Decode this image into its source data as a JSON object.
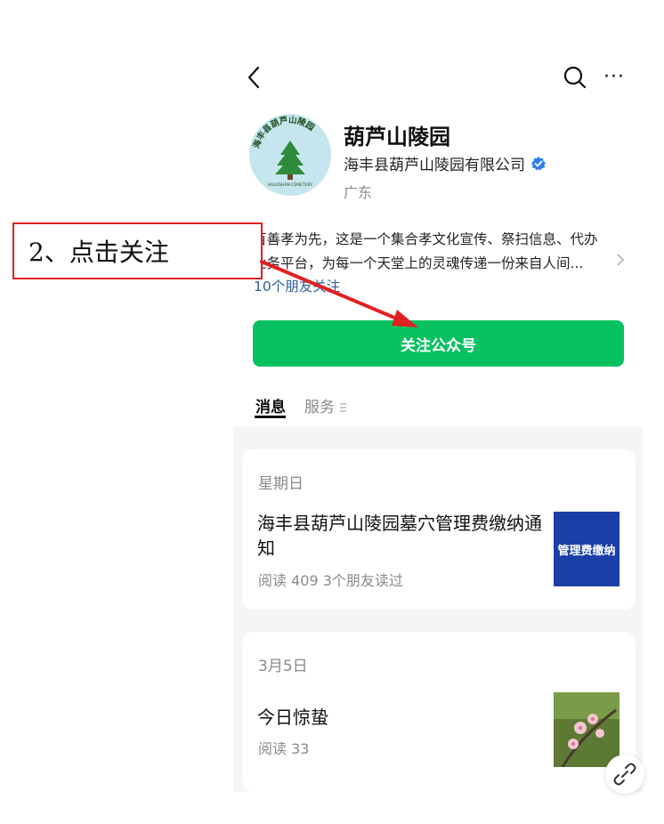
{
  "header": {
    "back_icon": "chevron-left-icon",
    "search_icon": "search-icon",
    "more_label": "···"
  },
  "account": {
    "avatar_text_top": "海丰县葫芦山陵园",
    "avatar_text_bottom": "HULUSHAN CEMETERY",
    "name": "葫芦山陵园",
    "owner": "海丰县葫芦山陵园有限公司",
    "verified_icon": "verified-badge-icon",
    "region": "广东",
    "description_line1": "百善孝为先，这是一个集合孝文化宣传、祭扫信息、代办",
    "description_line2": "业务平台，为每一个天堂上的灵魂传递一份来自人间...",
    "friends_following": "10个朋友关注",
    "follow_button": "关注公众号"
  },
  "tabs": [
    {
      "label": "消息",
      "active": true
    },
    {
      "label": "服务",
      "icon": "menu-lines-icon"
    }
  ],
  "articles": [
    {
      "date": "星期日",
      "title_line1": "海丰县葫芦山陵园墓穴管理费缴纳通",
      "title_line2": "知",
      "meta": "阅读 409   3个朋友读过",
      "thumb_text": "管理费缴纳"
    },
    {
      "date": "3月5日",
      "title_line1": "今日惊蛰",
      "meta": "阅读 33"
    }
  ],
  "floating_button_icon": "link-icon",
  "annotation": {
    "label": "2、点击关注",
    "color": "#e02020"
  },
  "colors": {
    "accent_green": "#07c160",
    "link_blue": "#2b5f9e",
    "annotation_red": "#e02020"
  }
}
